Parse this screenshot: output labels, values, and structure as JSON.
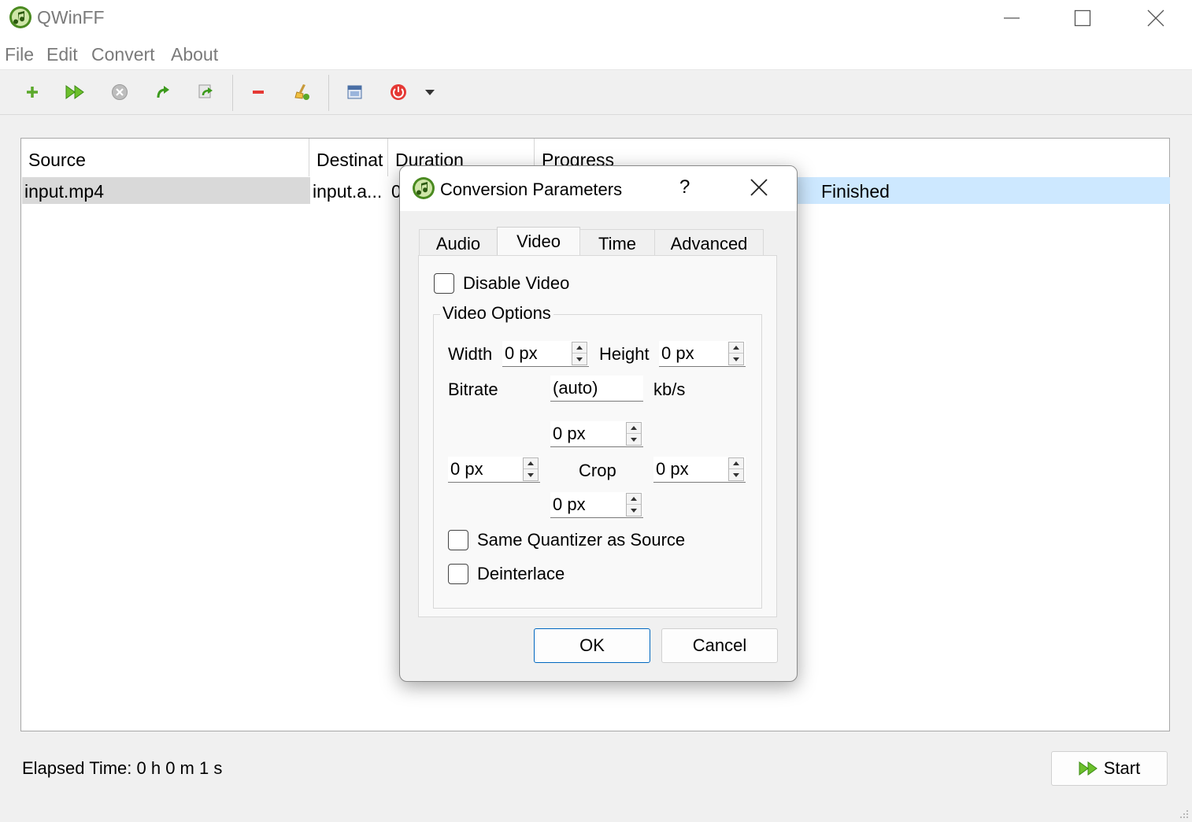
{
  "window": {
    "title": "QWinFF",
    "controls": {
      "minimize": "minimize",
      "maximize": "maximize",
      "close": "close"
    }
  },
  "menu": {
    "items": [
      "File",
      "Edit",
      "Convert",
      "About"
    ]
  },
  "toolbar": {
    "buttons": [
      "add-icon",
      "fast-forward-icon",
      "stop-icon",
      "redo-icon",
      "retry-icon",
      "remove-icon",
      "clear-icon",
      "folder-icon",
      "power-icon",
      "dropdown-arrow-icon"
    ]
  },
  "table": {
    "columns": [
      "Source",
      "Destinat",
      "Duration",
      "Progress"
    ],
    "rows": [
      {
        "source": "input.mp4",
        "destination": "input.a...",
        "duration": "0",
        "progress": "Finished"
      }
    ]
  },
  "status": {
    "elapsed": "Elapsed Time: 0 h 0 m 1 s",
    "start_label": "Start"
  },
  "dialog": {
    "title": "Conversion Parameters",
    "help": "?",
    "tabs": [
      "Audio",
      "Video",
      "Time",
      "Advanced"
    ],
    "active_tab": "Video",
    "disable_video": {
      "label": "Disable Video",
      "checked": false
    },
    "group_title": "Video Options",
    "width_label": "Width",
    "width_value": "0 px",
    "height_label": "Height",
    "height_value": "0 px",
    "bitrate_label": "Bitrate",
    "bitrate_value": "(auto)",
    "bitrate_unit": "kb/s",
    "crop_label": "Crop",
    "crop_top": "0 px",
    "crop_left": "0 px",
    "crop_right": "0 px",
    "crop_bottom": "0 px",
    "same_quantizer": {
      "label": "Same Quantizer as Source",
      "checked": false
    },
    "deinterlace": {
      "label": "Deinterlace",
      "checked": false
    },
    "ok_label": "OK",
    "cancel_label": "Cancel"
  },
  "colors": {
    "selected_row": "#cde8ff",
    "source_cell_bg": "#d9d9d9",
    "accent": "#0067c0",
    "toolbar_green": "#5aa82a"
  }
}
